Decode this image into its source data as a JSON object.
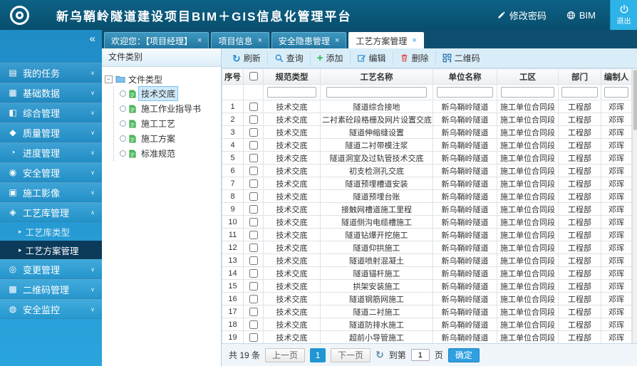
{
  "header": {
    "title": "新乌鞘岭隧道建设项目BIM＋GIS信息化管理平台",
    "change_password_label": "修改密码",
    "bim_label": "BIM",
    "logout_label": "退出"
  },
  "tab_bar": {
    "collapse_icon": "«",
    "close_icon": "×",
    "tabs": [
      {
        "label": "欢迎您：【项目经理】",
        "active": false
      },
      {
        "label": "项目信息",
        "active": false
      },
      {
        "label": "安全隐患管理",
        "active": false
      },
      {
        "label": "工艺方案管理",
        "active": true
      }
    ]
  },
  "sidebar": {
    "items": [
      {
        "label": "我的任务",
        "glyph": "▤",
        "chevron": "∨"
      },
      {
        "label": "基础数据",
        "glyph": "▦",
        "chevron": "∨"
      },
      {
        "label": "综合管理",
        "glyph": "◧",
        "chevron": "∨"
      },
      {
        "label": "质量管理",
        "glyph": "◆",
        "chevron": "∨"
      },
      {
        "label": "进度管理",
        "glyph": "◔",
        "chevron": "∨"
      },
      {
        "label": "安全管理",
        "glyph": "◉",
        "chevron": "∨"
      },
      {
        "label": "施工影像",
        "glyph": "▣",
        "chevron": "∨"
      },
      {
        "label": "工艺库管理",
        "glyph": "◈",
        "chevron": "∧",
        "children": [
          {
            "label": "工艺库类型",
            "active": false
          },
          {
            "label": "工艺方案管理",
            "active": true
          }
        ]
      },
      {
        "label": "变更管理",
        "glyph": "◎",
        "chevron": "∨"
      },
      {
        "label": "二维码管理",
        "glyph": "▩",
        "chevron": "∨"
      },
      {
        "label": "安全监控",
        "glyph": "◍",
        "chevron": "∨"
      }
    ]
  },
  "tree_panel": {
    "title": "文件类别",
    "root_label": "文件类型",
    "items": [
      {
        "label": "技术交底",
        "selected": true
      },
      {
        "label": "施工作业指导书",
        "selected": false
      },
      {
        "label": "施工工艺",
        "selected": false
      },
      {
        "label": "施工方案",
        "selected": false
      },
      {
        "label": "标准规范",
        "selected": false
      }
    ]
  },
  "toolbar": {
    "buttons": [
      {
        "id": "refresh",
        "label": "刷新"
      },
      {
        "id": "search",
        "label": "查询"
      },
      {
        "id": "add",
        "label": "添加"
      },
      {
        "id": "edit",
        "label": "编辑"
      },
      {
        "id": "delete",
        "label": "删除"
      },
      {
        "id": "qrcode",
        "label": "二维码"
      }
    ]
  },
  "table": {
    "headers": {
      "no": "序号",
      "type": "规范类型",
      "name": "工艺名称",
      "unit": "单位名称",
      "area": "工区",
      "dept": "部门",
      "author": "编制人"
    },
    "rows": [
      {
        "no": "1",
        "type": "技术交底",
        "name": "隧道综合接地",
        "unit": "新乌鞘岭隧道",
        "area": "施工单位合同段",
        "dept": "工程部",
        "author": "邓珲"
      },
      {
        "no": "2",
        "type": "技术交底",
        "name": "二衬素砼段格栅及网片设置交底",
        "unit": "新乌鞘岭隧道",
        "area": "施工单位合同段",
        "dept": "工程部",
        "author": "邓珲"
      },
      {
        "no": "3",
        "type": "技术交底",
        "name": "隧道伸缩缝设置",
        "unit": "新乌鞘岭隧道",
        "area": "施工单位合同段",
        "dept": "工程部",
        "author": "邓珲"
      },
      {
        "no": "4",
        "type": "技术交底",
        "name": "隧道二衬带模注浆",
        "unit": "新乌鞘岭隧道",
        "area": "施工单位合同段",
        "dept": "工程部",
        "author": "邓珲"
      },
      {
        "no": "5",
        "type": "技术交底",
        "name": "隧道洞室及过轨管技术交底",
        "unit": "新乌鞘岭隧道",
        "area": "施工单位合同段",
        "dept": "工程部",
        "author": "邓珲"
      },
      {
        "no": "6",
        "type": "技术交底",
        "name": "初支检测孔交底",
        "unit": "新乌鞘岭隧道",
        "area": "施工单位合同段",
        "dept": "工程部",
        "author": "邓珲"
      },
      {
        "no": "7",
        "type": "技术交底",
        "name": "隧道预埋槽道安装",
        "unit": "新乌鞘岭隧道",
        "area": "施工单位合同段",
        "dept": "工程部",
        "author": "邓珲"
      },
      {
        "no": "8",
        "type": "技术交底",
        "name": "隧道预埋台账",
        "unit": "新乌鞘岭隧道",
        "area": "施工单位合同段",
        "dept": "工程部",
        "author": "邓珲"
      },
      {
        "no": "9",
        "type": "技术交底",
        "name": "接触网槽道施工里程",
        "unit": "新乌鞘岭隧道",
        "area": "施工单位合同段",
        "dept": "工程部",
        "author": "邓珲"
      },
      {
        "no": "10",
        "type": "技术交底",
        "name": "隧道侧沟电缆槽施工",
        "unit": "新乌鞘岭隧道",
        "area": "施工单位合同段",
        "dept": "工程部",
        "author": "邓珲"
      },
      {
        "no": "11",
        "type": "技术交底",
        "name": "隧道钻爆开挖施工",
        "unit": "新乌鞘岭隧道",
        "area": "施工单位合同段",
        "dept": "工程部",
        "author": "邓珲"
      },
      {
        "no": "12",
        "type": "技术交底",
        "name": "隧道仰拱施工",
        "unit": "新乌鞘岭隧道",
        "area": "施工单位合同段",
        "dept": "工程部",
        "author": "邓珲"
      },
      {
        "no": "13",
        "type": "技术交底",
        "name": "隧道喷射混凝土",
        "unit": "新乌鞘岭隧道",
        "area": "施工单位合同段",
        "dept": "工程部",
        "author": "邓珲"
      },
      {
        "no": "14",
        "type": "技术交底",
        "name": "隧道锚杆施工",
        "unit": "新乌鞘岭隧道",
        "area": "施工单位合同段",
        "dept": "工程部",
        "author": "邓珲"
      },
      {
        "no": "15",
        "type": "技术交底",
        "name": "拱架安装施工",
        "unit": "新乌鞘岭隧道",
        "area": "施工单位合同段",
        "dept": "工程部",
        "author": "邓珲"
      },
      {
        "no": "16",
        "type": "技术交底",
        "name": "隧道钢筋网施工",
        "unit": "新乌鞘岭隧道",
        "area": "施工单位合同段",
        "dept": "工程部",
        "author": "邓珲"
      },
      {
        "no": "17",
        "type": "技术交底",
        "name": "隧道二衬施工",
        "unit": "新乌鞘岭隧道",
        "area": "施工单位合同段",
        "dept": "工程部",
        "author": "邓珲"
      },
      {
        "no": "18",
        "type": "技术交底",
        "name": "隧道防排水施工",
        "unit": "新乌鞘岭隧道",
        "area": "施工单位合同段",
        "dept": "工程部",
        "author": "邓珲"
      },
      {
        "no": "19",
        "type": "技术交底",
        "name": "超前小导管施工",
        "unit": "新乌鞘岭隧道",
        "area": "施工单位合同段",
        "dept": "工程部",
        "author": "邓珲"
      }
    ]
  },
  "pagination": {
    "total_text": "共 19 条",
    "prev_label": "上一页",
    "current_page": "1",
    "next_label": "下一页",
    "reload_icon": "↻",
    "goto_prefix": "到第",
    "goto_value": "1",
    "goto_suffix": "页",
    "confirm_label": "确定"
  },
  "colors": {
    "header_bg": "#0a5878",
    "sidebar_bg": "#2492cc",
    "accent_blue": "#2196d3",
    "active_nav_bg": "#0b3a5a",
    "toolbar_bg": "#d9edf9",
    "add_green": "#2eb84a",
    "delete_red": "#e04444",
    "logout_bg": "#2db3e8"
  }
}
